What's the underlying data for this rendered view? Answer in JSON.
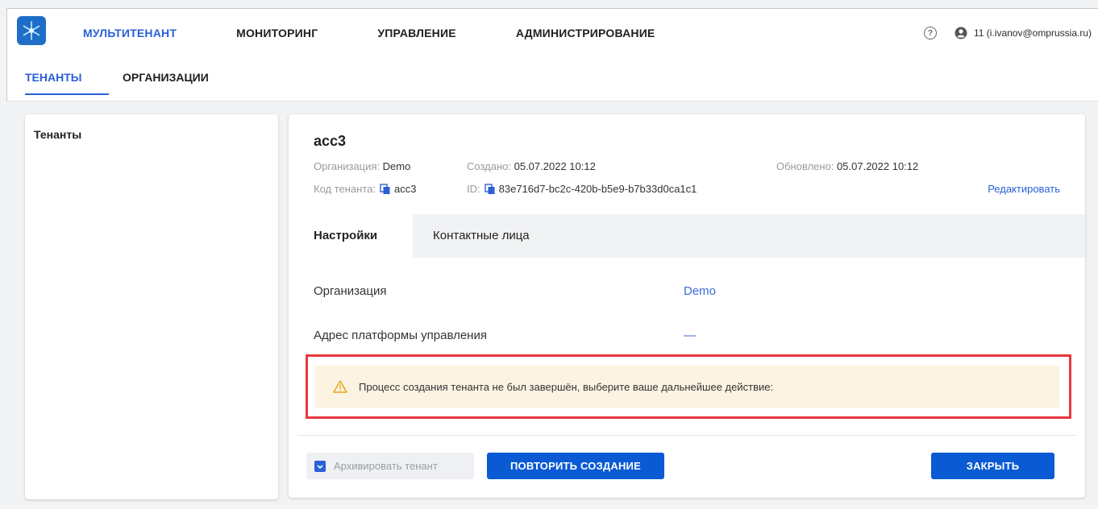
{
  "nav": {
    "items": [
      "МУЛЬТИТЕНАНТ",
      "МОНИТОРИНГ",
      "УПРАВЛЕНИЕ",
      "АДМИНИСТРИРОВАНИЕ"
    ],
    "active_index": 0,
    "user": "11 (i.ivanov@omprussia.ru)",
    "help_icon": "question-circle-icon",
    "user_icon": "account-circle-icon"
  },
  "subnav": {
    "tabs": [
      "ТЕНАНТЫ",
      "ОРГАНИЗАЦИИ"
    ],
    "active_index": 0
  },
  "sidebar": {
    "title": "Тенанты"
  },
  "tenant": {
    "name": "acc3",
    "org_label": "Организация:",
    "org_value": "Demo",
    "created_label": "Создано:",
    "created_value": "05.07.2022 10:12",
    "updated_label": "Обновлено:",
    "updated_value": "05.07.2022 10:12",
    "code_label": "Код тенанта:",
    "code_value": "acc3",
    "id_label": "ID:",
    "id_value": "83e716d7-bc2c-420b-b5e9-b7b33d0ca1c1",
    "edit_link": "Редактировать"
  },
  "tabs": [
    "Настройки",
    "Контактные лица"
  ],
  "settings": {
    "rows": [
      {
        "label": "Организация",
        "value": "Demo"
      },
      {
        "label": "Адрес платформы управления",
        "value": "—"
      }
    ]
  },
  "alert": {
    "text": "Процесс создания тенанта не был завершён, выберите ваше дальнейшее действие:"
  },
  "actions": {
    "archive": "Архивировать тенант",
    "retry": "ПОВТОРИТЬ СОЗДАНИЕ",
    "close": "ЗАКРЫТЬ"
  },
  "colors": {
    "accent": "#2a5fd6",
    "primary_button": "#0a5ad4",
    "alert_bg": "#fdf3e3",
    "highlight_border": "#e8373d"
  }
}
